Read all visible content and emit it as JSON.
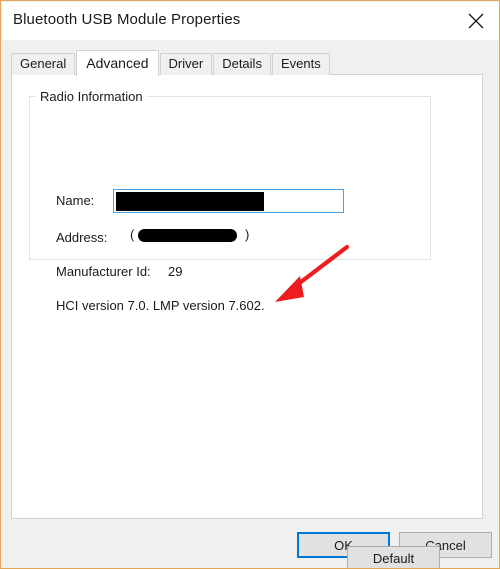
{
  "window": {
    "title": "Bluetooth USB Module Properties",
    "close_icon": "close-icon",
    "border_color": "#e2a757"
  },
  "tabs": [
    {
      "label": "General",
      "selected": false
    },
    {
      "label": "Advanced",
      "selected": true
    },
    {
      "label": "Driver",
      "selected": false
    },
    {
      "label": "Details",
      "selected": false
    },
    {
      "label": "Events",
      "selected": false
    }
  ],
  "group": {
    "legend": "Radio Information",
    "name": {
      "label": "Name:",
      "value": "",
      "placeholder": "",
      "redacted": true
    },
    "address": {
      "label": "Address:",
      "open_paren": "(",
      "close_paren": ")",
      "value": "",
      "redacted": true
    },
    "manufacturer": {
      "label": "Manufacturer Id:",
      "value": "29"
    },
    "version": {
      "text": "HCI version 7.0.  LMP version 7.602."
    }
  },
  "annotation": {
    "type": "arrow",
    "color": "#ee1c1c",
    "points_to": "HCI version 7.0.  LMP version 7.602."
  },
  "buttons": {
    "default_label": "Default",
    "ok_label": "OK",
    "cancel_label": "Cancel",
    "focus_color": "#0078d7"
  }
}
